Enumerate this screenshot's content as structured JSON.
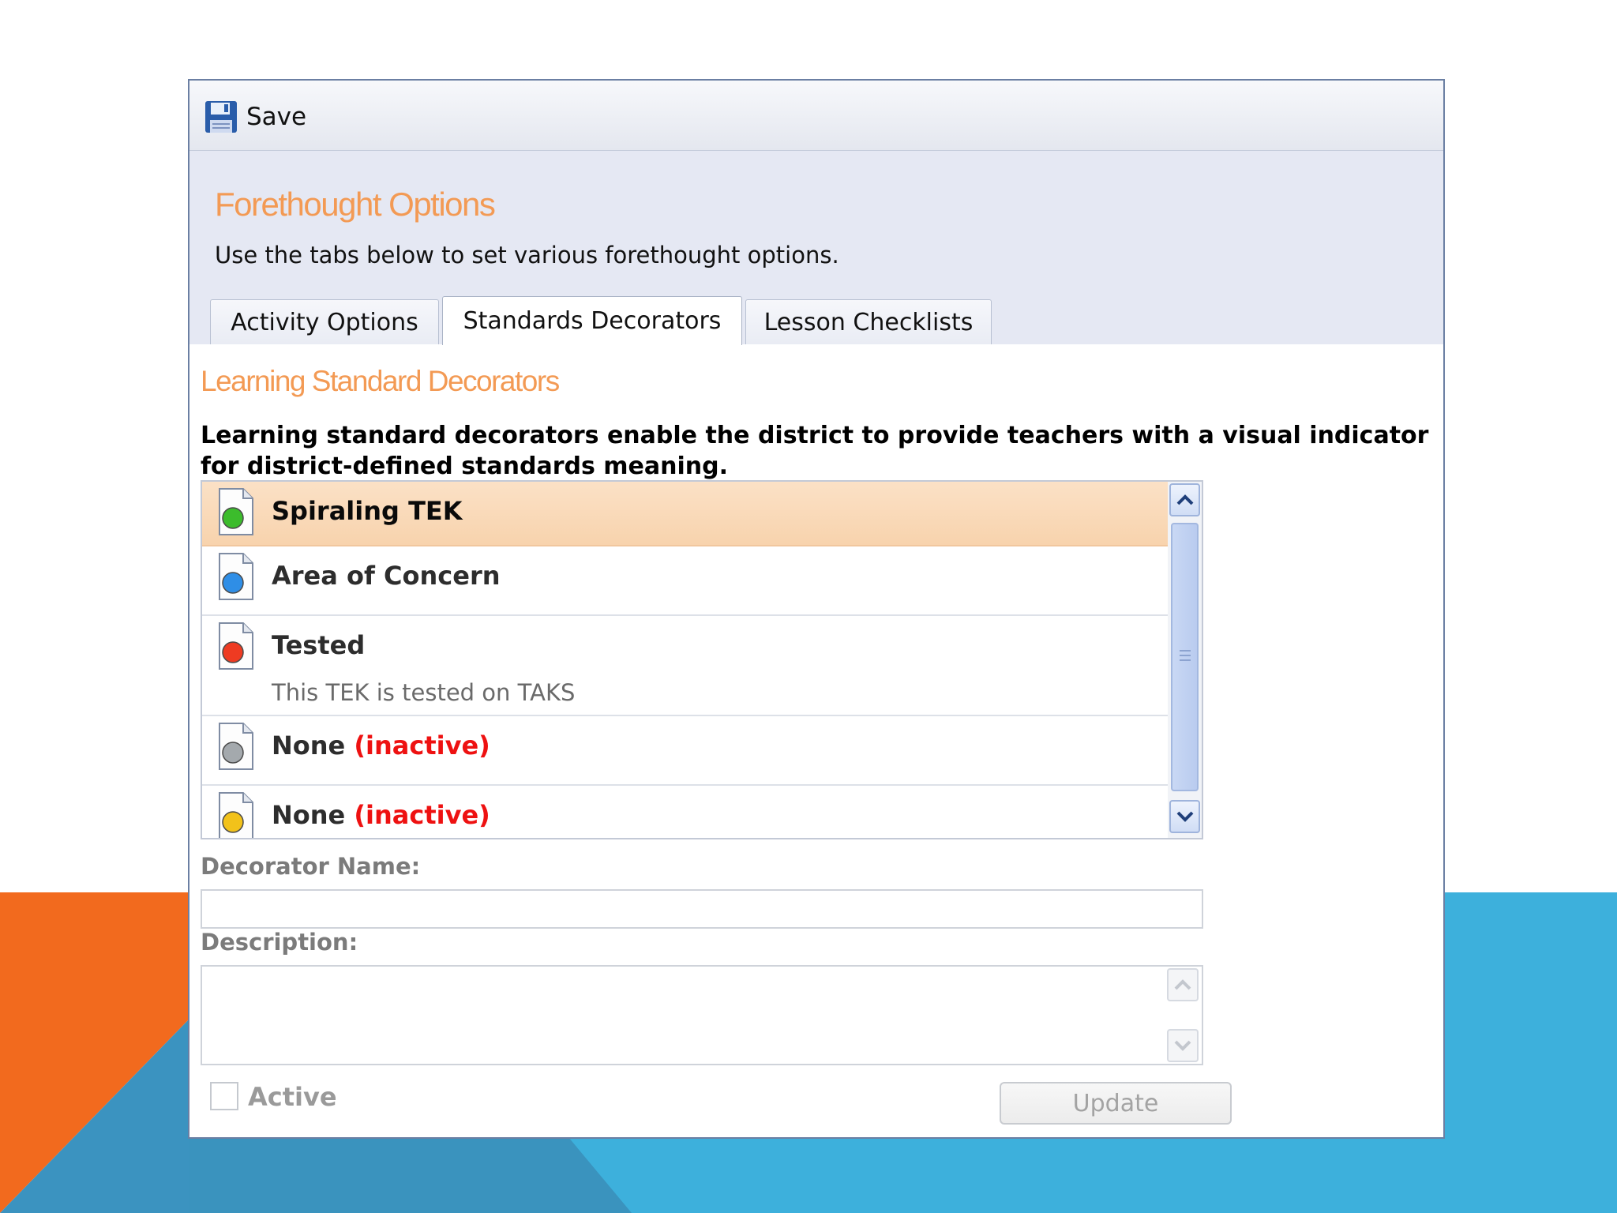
{
  "toolbar": {
    "save_label": "Save"
  },
  "header": {
    "title": "Forethought Options",
    "subtitle": "Use the tabs below to set various forethought options."
  },
  "tabs": [
    {
      "label": "Activity Options"
    },
    {
      "label": "Standards Decorators",
      "active": true
    },
    {
      "label": "Lesson Checklists"
    }
  ],
  "section": {
    "title": "Learning Standard Decorators",
    "intro": "Learning standard decorators enable the district to provide teachers with a visual indicator for district-defined standards meaning."
  },
  "decorators": [
    {
      "name": "Spiraling TEK",
      "status": "",
      "description": "",
      "dot_color": "#3cbc2c",
      "selected": true
    },
    {
      "name": "Area of Concern",
      "status": "",
      "description": "",
      "dot_color": "#2f8ee6"
    },
    {
      "name": "Tested",
      "status": "",
      "description": "This TEK is tested on TAKS",
      "dot_color": "#ee3b22"
    },
    {
      "name": "None",
      "status": "(inactive)",
      "description": "",
      "dot_color": "#a4a9ad"
    },
    {
      "name": "None",
      "status": "(inactive)",
      "description": "",
      "dot_color": "#f2c21a"
    }
  ],
  "form": {
    "name_label": "Decorator Name:",
    "name_value": "",
    "description_label": "Description:",
    "description_value": "",
    "active_label": "Active",
    "active_checked": false,
    "update_label": "Update"
  },
  "colors": {
    "accent_orange": "#f39a54",
    "inactive_red": "#ee1111",
    "background_orange": "#f26a1e",
    "background_blue": "#3db0dc"
  }
}
